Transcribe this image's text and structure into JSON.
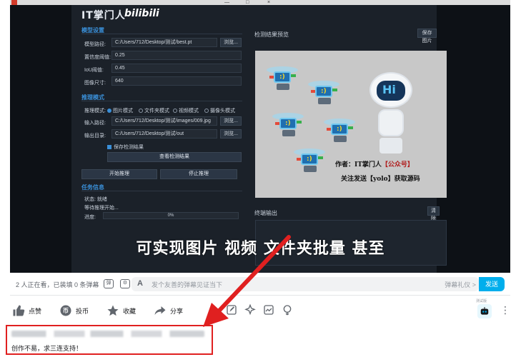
{
  "app": {
    "title_cn": "IT掌门人",
    "title_logo": "bilibili",
    "model_section": "模型设置",
    "model_rows": [
      {
        "label": "模型路径:",
        "value": "C:/Users/712/Desktop/测试/best.pt",
        "browse": "浏览..."
      },
      {
        "label": "置信度阈值:",
        "value": "0.25"
      },
      {
        "label": "IoU阈值:",
        "value": "0.45"
      },
      {
        "label": "图像尺寸:",
        "value": "640"
      }
    ],
    "infer_section": "推理模式",
    "infer_mode_label": "推理模式:",
    "modes": [
      "图片模式",
      "文件夹模式",
      "视频模式",
      "摄像头模式"
    ],
    "input_label": "输入路径:",
    "input_value": "C:/Users/712/Desktop/测试/images/009.jpg",
    "input_browse": "浏览...",
    "output_label": "输出目录:",
    "output_value": "C:/Users/712/Desktop/测试/out",
    "output_browse": "浏览...",
    "save_results": "保存检测结果",
    "view_results": "查看检测结果",
    "start_button": "开始推理",
    "stop_button": "停止推理",
    "task_section": "任务信息",
    "status_text": "状态: 就绪",
    "waiting_text": "等待推理开始...",
    "progress_label": "进度:",
    "progress_value": "0%",
    "preview_title": "检测结果预览",
    "save_image_button": "保存图片",
    "terminal_title": "终端输出",
    "clear_button": "清除",
    "preview_caption1_a": "作者：IT掌门人",
    "preview_caption1_b": "【公众号】",
    "preview_caption2": "关注发送【yolo】获取源码",
    "preview_hi": "Hi"
  },
  "subtitle": "可实现图片 视频 文件夹批量 甚至",
  "danmaku": {
    "viewers": "2 人正在看，已装填 0 条弹幕",
    "placeholder": "发个友善的弹幕见证当下",
    "etiquette": "弹幕礼仪 >",
    "send": "发送"
  },
  "actions": {
    "like": "点赞",
    "coin": "投币",
    "favorite": "收藏",
    "share": "分享",
    "bot_tag": "测试版"
  },
  "comment": {
    "text": "创作不易，求三连支持！"
  },
  "colors": {
    "accent": "#00aeec",
    "highlight_red": "#e02020",
    "app_bg": "#1b2129",
    "section_blue": "#3a8fd8"
  }
}
